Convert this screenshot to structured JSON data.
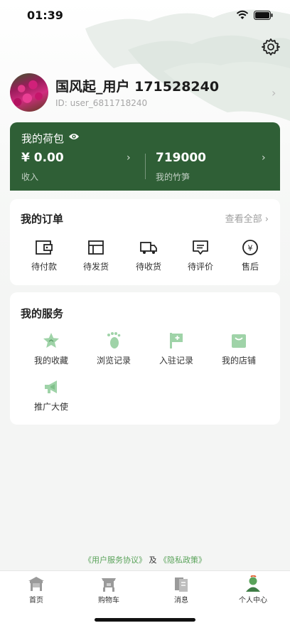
{
  "status_bar": {
    "time": "01:39"
  },
  "profile": {
    "username": "国风起_用户 171528240",
    "user_id": "ID: user_6811718240"
  },
  "wallet": {
    "title": "我的荷包",
    "income_amount": "¥ 0.00",
    "income_label": "收入",
    "bamboo_amount": "719000",
    "bamboo_label": "我的竹笋"
  },
  "orders": {
    "title": "我的订单",
    "view_all": "查看全部",
    "items": [
      {
        "label": "待付款",
        "icon": "pending-payment-icon"
      },
      {
        "label": "待发货",
        "icon": "pending-shipment-icon"
      },
      {
        "label": "待收货",
        "icon": "delivery-truck-icon"
      },
      {
        "label": "待评价",
        "icon": "pending-review-icon"
      },
      {
        "label": "售后",
        "icon": "after-sales-icon"
      }
    ]
  },
  "services": {
    "title": "我的服务",
    "items": [
      {
        "label": "我的收藏",
        "icon": "star-favorites-icon"
      },
      {
        "label": "浏览记录",
        "icon": "footprint-icon"
      },
      {
        "label": "入驻记录",
        "icon": "flag-plus-icon"
      },
      {
        "label": "我的店铺",
        "icon": "shop-bag-icon"
      },
      {
        "label": "推广大使",
        "icon": "megaphone-icon"
      }
    ]
  },
  "agreement": {
    "user_agreement": "《用户服务协议》",
    "and": " 及 ",
    "privacy_policy": "《隐私政策》"
  },
  "tabbar": {
    "items": [
      {
        "label": "首页",
        "icon": "home-pavilion-icon"
      },
      {
        "label": "购物车",
        "icon": "cart-icon"
      },
      {
        "label": "消息",
        "icon": "message-icon"
      },
      {
        "label": "个人中心",
        "icon": "profile-icon",
        "active": true
      }
    ]
  },
  "colors": {
    "wallet_bg": "#2f5f36",
    "accent_green": "#5aa35a",
    "service_icon": "#9fd3a8"
  }
}
